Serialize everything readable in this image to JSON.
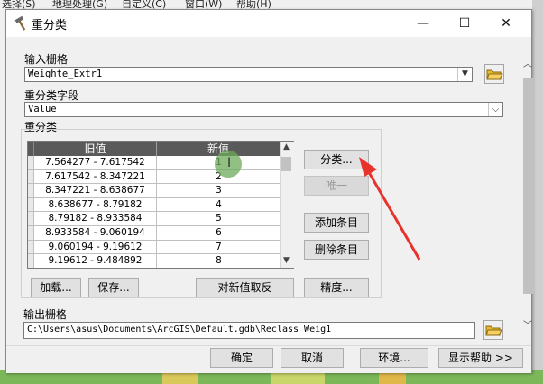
{
  "background_app": {
    "menu": [
      "选择(S)",
      "地理处理(G)",
      "自定义(C)",
      "窗口(W)",
      "帮助(H)"
    ]
  },
  "dialog": {
    "title": "重分类",
    "minimize_glyph": "—",
    "maximize_glyph": "☐",
    "close_glyph": "✕",
    "input_raster": {
      "label": "输入栅格",
      "value": "Weighte_Extr1"
    },
    "reclass_field": {
      "label": "重分类字段",
      "value": "Value"
    },
    "reclassification": {
      "label": "重分类",
      "columns": [
        "旧值",
        "新值"
      ],
      "rows": [
        {
          "old": "7.564277 - 7.617542",
          "new": "1"
        },
        {
          "old": "7.617542 - 8.347221",
          "new": "2"
        },
        {
          "old": "8.347221 - 8.638677",
          "new": "3"
        },
        {
          "old": "8.638677 - 8.79182",
          "new": "4"
        },
        {
          "old": "8.79182 - 8.933584",
          "new": "5"
        },
        {
          "old": "8.933584 - 9.060194",
          "new": "6"
        },
        {
          "old": "9.060194 - 9.19612",
          "new": "7"
        },
        {
          "old": "9.19612 - 9.484892",
          "new": "8"
        }
      ]
    },
    "side_buttons": {
      "classify": "分类...",
      "unique": "唯一",
      "add_entry": "添加条目",
      "delete_entry": "删除条目"
    },
    "lower_buttons": {
      "load": "加载...",
      "save": "保存...",
      "reverse": "对新值取反",
      "precision": "精度..."
    },
    "output_raster": {
      "label": "输出栅格",
      "value": "C:\\Users\\asus\\Documents\\ArcGIS\\Default.gdb\\Reclass_Weig1"
    },
    "footer_buttons": {
      "ok": "确定",
      "cancel": "取消",
      "environments": "环境...",
      "show_help": "显示帮助 >>"
    },
    "cursor_glyph": "I"
  },
  "colors": {
    "annotation": "#e8332c",
    "cursor_highlight": "#6eaa5a",
    "header_bg": "#5a5a5a"
  }
}
